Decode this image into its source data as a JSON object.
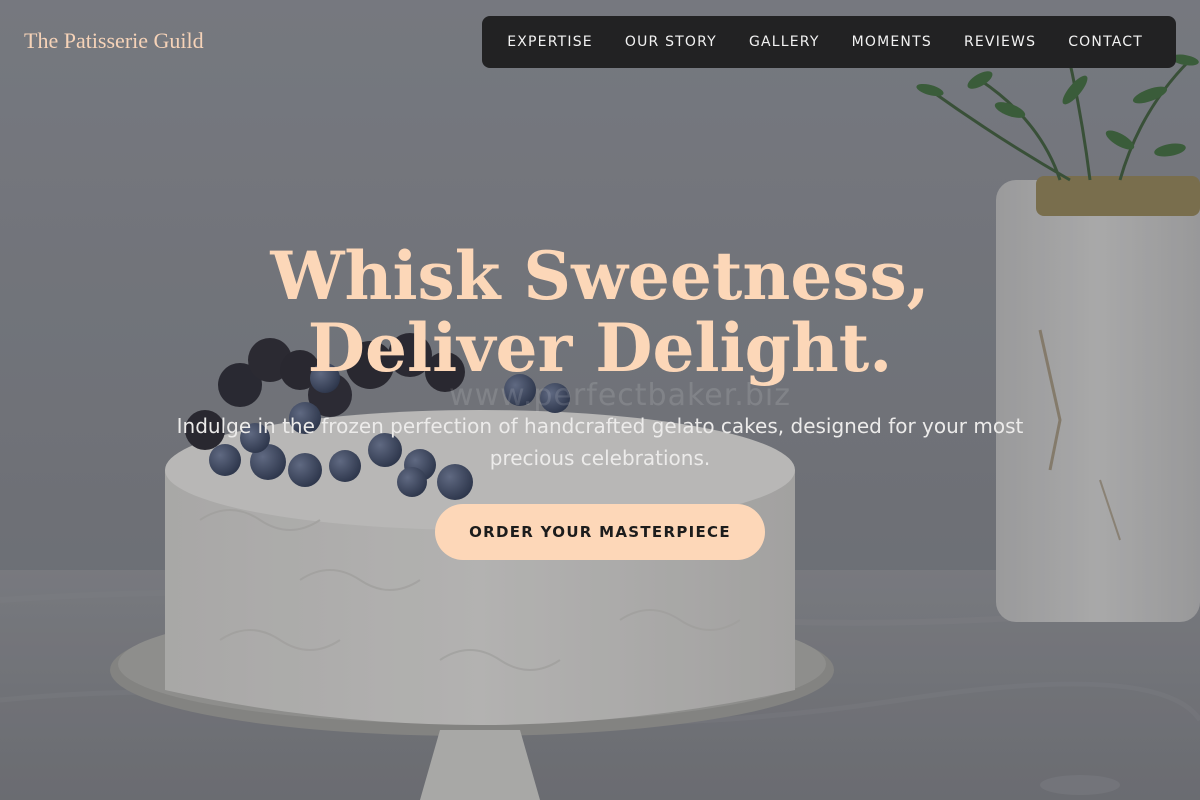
{
  "brand": {
    "name": "The Patisserie Guild"
  },
  "nav": {
    "items": [
      "EXPERTISE",
      "OUR STORY",
      "GALLERY",
      "MOMENTS",
      "REVIEWS",
      "CONTACT"
    ]
  },
  "hero": {
    "headline": "Whisk Sweetness, Deliver Delight.",
    "watermark": "www.perfectbaker.biz",
    "subline": "Indulge in the frozen perfection of handcrafted gelato cakes, designed for your most precious celebrations.",
    "cta_label": "ORDER YOUR MASTERPIECE"
  },
  "colors": {
    "accent": "#fdd7b8",
    "navbar_bg": "#222223",
    "brand_text": "#f6d3b8"
  }
}
